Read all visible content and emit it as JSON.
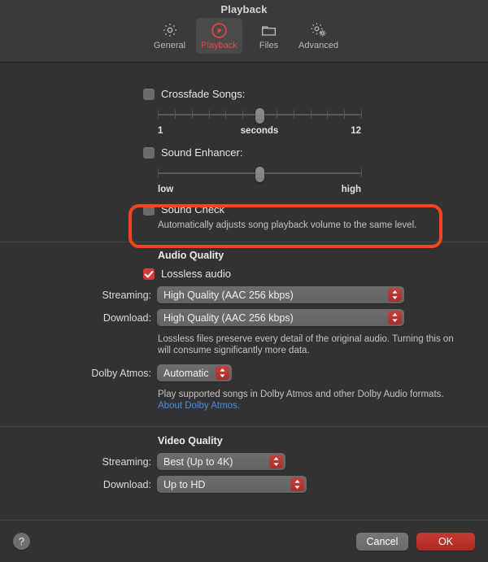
{
  "window": {
    "title": "Playback"
  },
  "toolbar": {
    "tabs": [
      {
        "label": "General",
        "icon": "gear-icon",
        "active": false
      },
      {
        "label": "Playback",
        "icon": "play-circle-icon",
        "active": true
      },
      {
        "label": "Files",
        "icon": "folder-icon",
        "active": false
      },
      {
        "label": "Advanced",
        "icon": "double-gear-icon",
        "active": false
      }
    ]
  },
  "playback": {
    "crossfade": {
      "label": "Crossfade Songs:",
      "checked": false,
      "slider": {
        "min_label": "1",
        "unit_label": "seconds",
        "max_label": "12",
        "value_percent": 50,
        "ticks": 13
      }
    },
    "sound_enhancer": {
      "label": "Sound Enhancer:",
      "checked": false,
      "slider": {
        "min_label": "low",
        "max_label": "high",
        "value_percent": 50,
        "ticks": 3
      }
    },
    "sound_check": {
      "label": "Sound Check",
      "checked": false,
      "description": "Automatically adjusts song playback volume to the same level.",
      "highlighted": true,
      "highlight_color": "#f4451f"
    }
  },
  "audio_quality": {
    "title": "Audio Quality",
    "lossless": {
      "label": "Lossless audio",
      "checked": true
    },
    "streaming": {
      "label": "Streaming:",
      "value": "High Quality (AAC 256 kbps)"
    },
    "download": {
      "label": "Download:",
      "value": "High Quality (AAC 256 kbps)"
    },
    "lossless_description": "Lossless files preserve every detail of the original audio. Turning this on will consume significantly more data.",
    "dolby_atmos": {
      "label": "Dolby Atmos:",
      "value": "Automatic"
    },
    "dolby_description": "Play supported songs in Dolby Atmos and other Dolby Audio formats.",
    "dolby_link": "About Dolby Atmos."
  },
  "video_quality": {
    "title": "Video Quality",
    "streaming": {
      "label": "Streaming:",
      "value": "Best (Up to 4K)"
    },
    "download": {
      "label": "Download:",
      "value": "Up to HD"
    }
  },
  "footer": {
    "help_label": "?",
    "cancel_label": "Cancel",
    "ok_label": "OK"
  },
  "colors": {
    "accent": "#d03b35",
    "link": "#4a90e2",
    "highlight": "#f4451f",
    "background": "#323232"
  }
}
